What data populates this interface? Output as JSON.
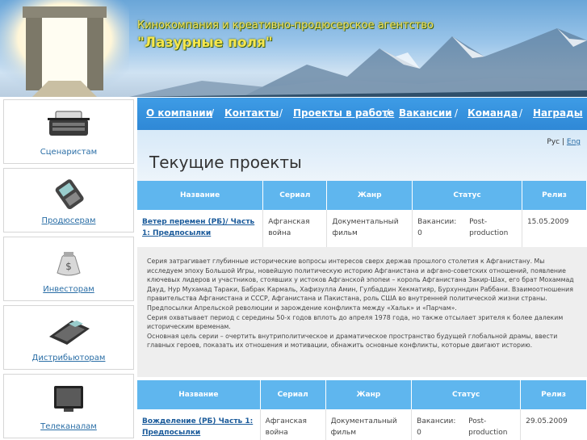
{
  "header": {
    "subtitle": "Кинокомпания и креативно-продюсерское агентство",
    "title": "\"Лазурные поля\""
  },
  "sidebar": {
    "items": [
      {
        "label": "Сценаристам",
        "icon": "typewriter-icon",
        "underlined": false
      },
      {
        "label": "Продюсерам",
        "icon": "mobile-phone-icon",
        "underlined": true
      },
      {
        "label": "Инвесторам",
        "icon": "money-bag-icon",
        "underlined": true
      },
      {
        "label": "Дистрибьюторам",
        "icon": "calculator-icon",
        "underlined": true
      },
      {
        "label": "Телеканалам",
        "icon": "tv-icon",
        "underlined": true
      }
    ]
  },
  "nav": {
    "items": [
      "О компании",
      "Контакты",
      "Проекты в работе",
      "Вакансии",
      "Команда",
      "Награды"
    ]
  },
  "lang": {
    "ru": "Рус",
    "sep": "|",
    "en": "Eng"
  },
  "page_title": "Текущие проекты",
  "table": {
    "headers": [
      "Название",
      "Сериал",
      "Жанр",
      "Статус",
      "Релиз"
    ]
  },
  "projects": [
    {
      "title": "Ветер перемен (РБ)/ Часть 1: Предпосылки",
      "series": "Афганская война",
      "genre": "Документальный фильм",
      "vacancies": "Вакансии: 0",
      "status": "Post-production",
      "release": "15.05.2009"
    },
    {
      "title": "Вожделение (РБ) Часть 1: Предпосылки",
      "series": "Афганская война",
      "genre": "Документальный фильм",
      "vacancies": "Вакансии: 0",
      "status": "Post-production",
      "release": "29.05.2009"
    }
  ],
  "description": [
    "Серия затрагивает глубинные исторические вопросы интересов сверх держав прошлого столетия к Афганистану. Мы исследуем эпоху Большой Игры, новейшую политическую историю Афганистана и афгано-советских отношений, появление ключевых лидеров и участников, стоявших у истоков Афганской эпопеи – король Афганистана Закир-Шах, его брат Мохаммад Дауд, Нур Мухамад Тараки, Бабрак Кармаль, Хафизулла Амин, Гулбаддин Хекматияр, Бурхунндин Раббани. Взаимоотношения правительства Афганистана и СССР, Афганистана и Пакистана, роль США во внутренней политической жизни страны. Предпосылки Апрельской революции и зарождение конфликта между «Хальк» и «Парчам».",
    "Серия охватывает период с середины 50-х годов вплоть до апреля 1978 года, но также отсылает зрителя к более далеким историческим временам.",
    "Основная цель серии – очертить внутриполитическое и драматическое пространство будущей глобальной драмы, ввести главных героев, показать их отношения и мотивации, обнажить основные конфликты, которые двигают историю."
  ]
}
